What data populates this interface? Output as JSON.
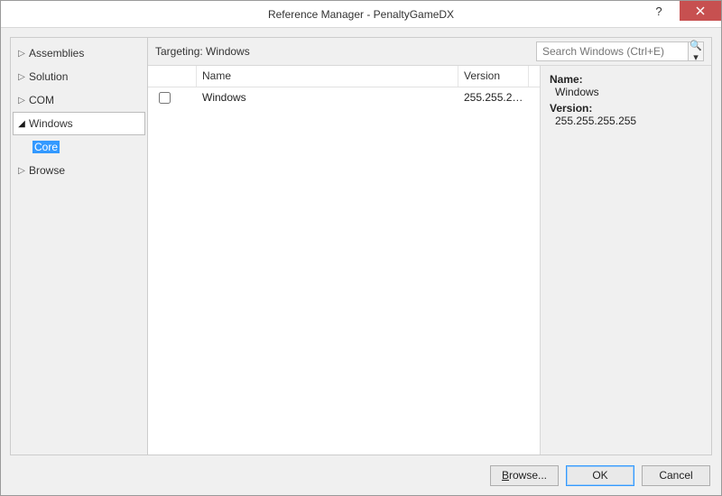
{
  "title": "Reference Manager - PenaltyGameDX",
  "sidebar": {
    "items": [
      {
        "label": "Assemblies",
        "expanded": false,
        "children": []
      },
      {
        "label": "Solution",
        "expanded": false,
        "children": []
      },
      {
        "label": "COM",
        "expanded": false,
        "children": []
      },
      {
        "label": "Windows",
        "expanded": true,
        "children": [
          {
            "label": "Core",
            "selected": true
          }
        ]
      },
      {
        "label": "Browse",
        "expanded": false,
        "children": []
      }
    ]
  },
  "topbar": {
    "targeting": "Targeting: Windows",
    "search_placeholder": "Search Windows (Ctrl+E)"
  },
  "list": {
    "headers": {
      "name": "Name",
      "version": "Version"
    },
    "rows": [
      {
        "checked": false,
        "name": "Windows",
        "version": "255.255.2…"
      }
    ]
  },
  "details": {
    "name_label": "Name:",
    "name_value": "Windows",
    "version_label": "Version:",
    "version_value": "255.255.255.255"
  },
  "footer": {
    "browse": "Browse...",
    "ok": "OK",
    "cancel": "Cancel"
  }
}
